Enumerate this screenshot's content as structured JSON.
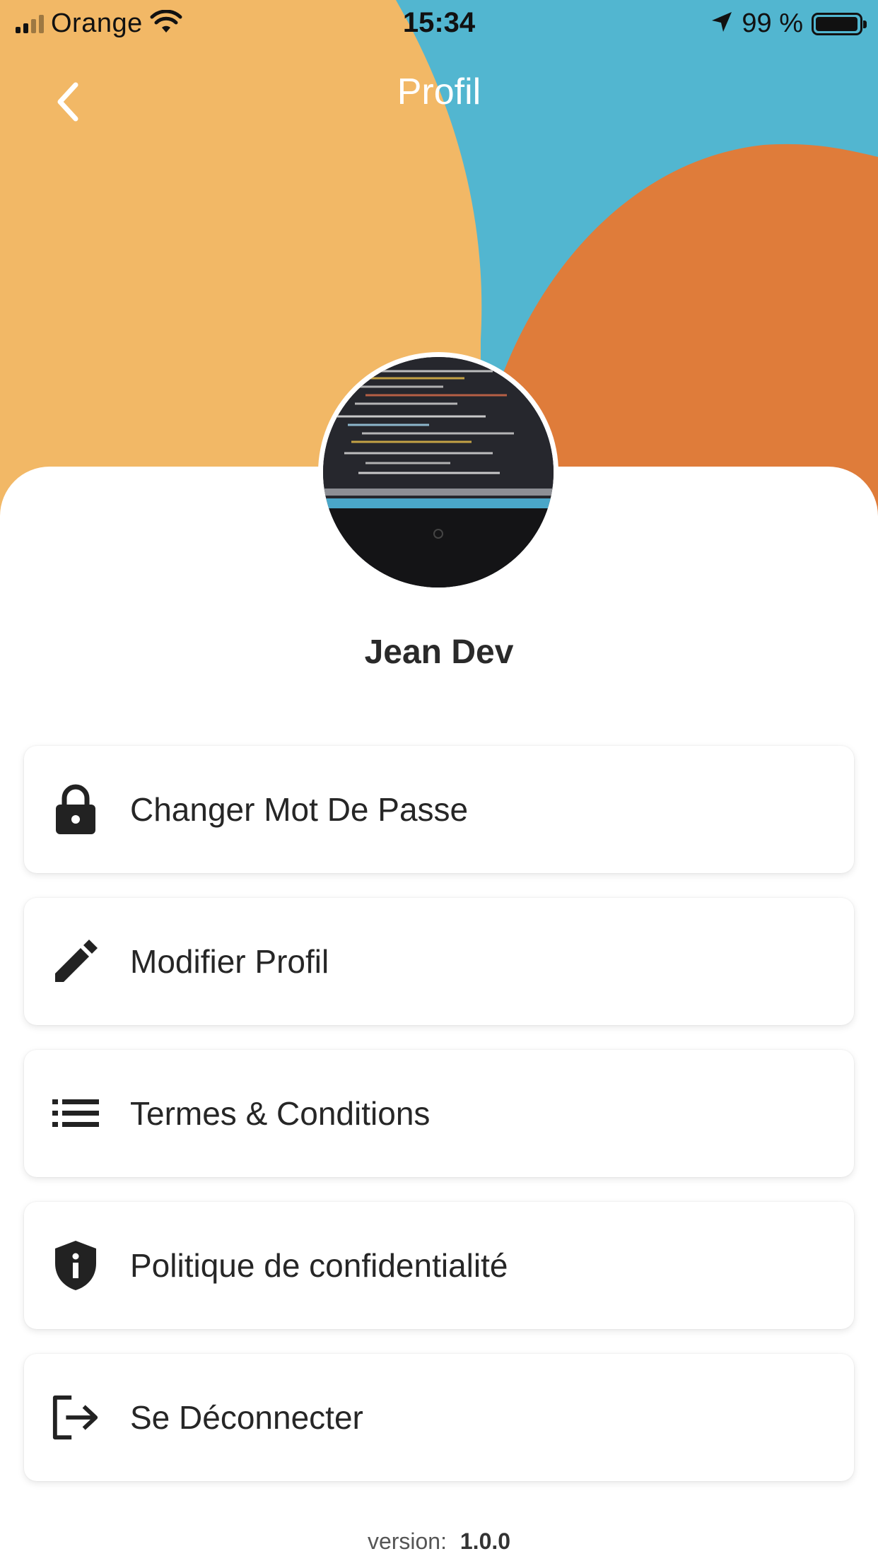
{
  "status_bar": {
    "carrier": "Orange",
    "time": "15:34",
    "battery_percent": "99 %",
    "battery_level": 0.99
  },
  "header": {
    "title": "Profil",
    "colors": {
      "yellow": "#F2B866",
      "blue": "#52B6D0",
      "orange": "#DF7C3A"
    }
  },
  "profile": {
    "name": "Jean Dev",
    "avatar": "code-on-laptop-photo"
  },
  "menu": [
    {
      "icon": "lock-icon",
      "label": "Changer Mot De Passe"
    },
    {
      "icon": "pencil-icon",
      "label": "Modifier Profil"
    },
    {
      "icon": "list-icon",
      "label": "Termes & Conditions"
    },
    {
      "icon": "shield-icon",
      "label": "Politique de confidentialité"
    },
    {
      "icon": "logout-icon",
      "label": "Se Déconnecter"
    }
  ],
  "footer": {
    "version_label": "version:",
    "version_value": "1.0.0"
  }
}
